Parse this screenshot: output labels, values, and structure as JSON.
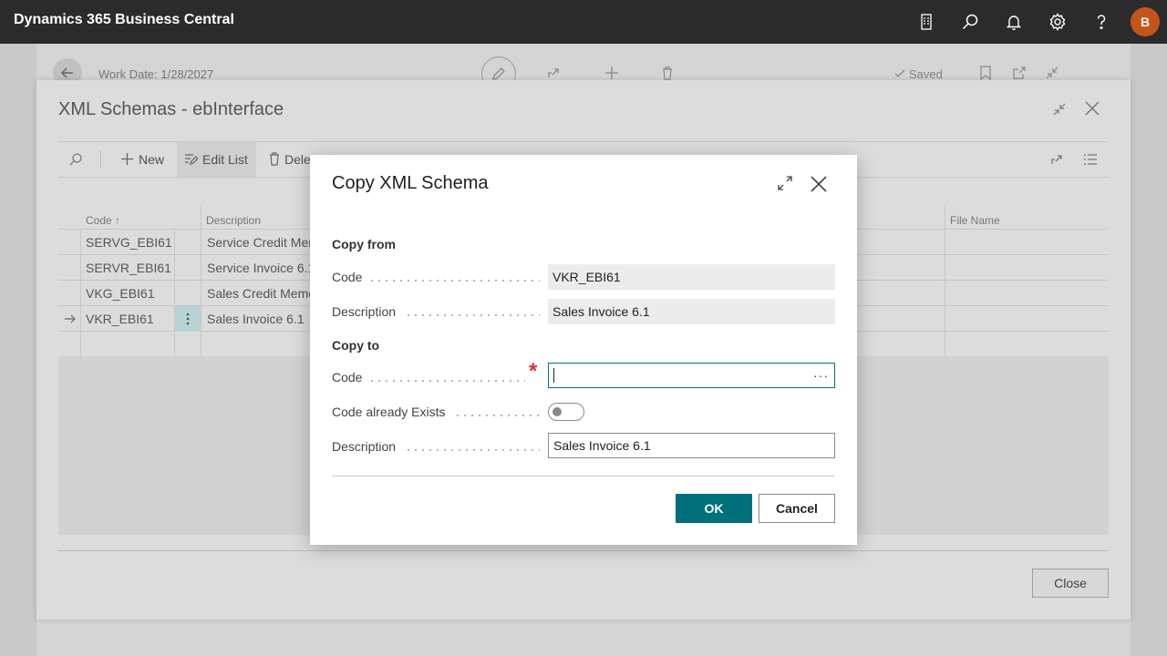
{
  "app": {
    "title": "Dynamics 365 Business Central",
    "avatar_initial": "B"
  },
  "background_page": {
    "work_date": "Work Date: 1/28/2027",
    "saved": "Saved"
  },
  "list_page": {
    "title": "XML Schemas - ebInterface",
    "toolbar": {
      "new": "New",
      "edit_list": "Edit List",
      "delete": "Dele"
    },
    "columns": {
      "code": "Code ↑",
      "description": "Description",
      "file_name": "File Name"
    },
    "rows": [
      {
        "code": "SERVG_EBI61",
        "description": "Service Credit Mem"
      },
      {
        "code": "SERVR_EBI61",
        "description": "Service Invoice 6.1"
      },
      {
        "code": "VKG_EBI61",
        "description": "Sales Credit Memo"
      },
      {
        "code": "VKR_EBI61",
        "description": "Sales Invoice 6.1",
        "selected": true
      }
    ],
    "close_label": "Close"
  },
  "dialog": {
    "title": "Copy XML Schema",
    "copy_from": {
      "heading": "Copy from",
      "code_label": "Code",
      "code_value": "VKR_EBI61",
      "description_label": "Description",
      "description_value": "Sales Invoice 6.1"
    },
    "copy_to": {
      "heading": "Copy to",
      "code_label": "Code",
      "code_value": "",
      "code_already_exists_label": "Code already Exists",
      "code_already_exists": false,
      "description_label": "Description",
      "description_value": "Sales Invoice 6.1"
    },
    "ok_label": "OK",
    "cancel_label": "Cancel"
  },
  "colors": {
    "accent": "#00707a",
    "appbar": "#2b2b2b",
    "avatar": "#c5541b",
    "required": "#d13438"
  },
  "icons": [
    "report-icon",
    "search-icon",
    "bell-icon",
    "gear-icon",
    "help-icon",
    "back-arrow-icon",
    "pencil-icon",
    "share-icon",
    "plus-icon",
    "trash-icon",
    "check-icon",
    "bookmark-icon",
    "open-new-icon",
    "collapse-icon",
    "close-icon",
    "expand-icon",
    "more-icon"
  ]
}
